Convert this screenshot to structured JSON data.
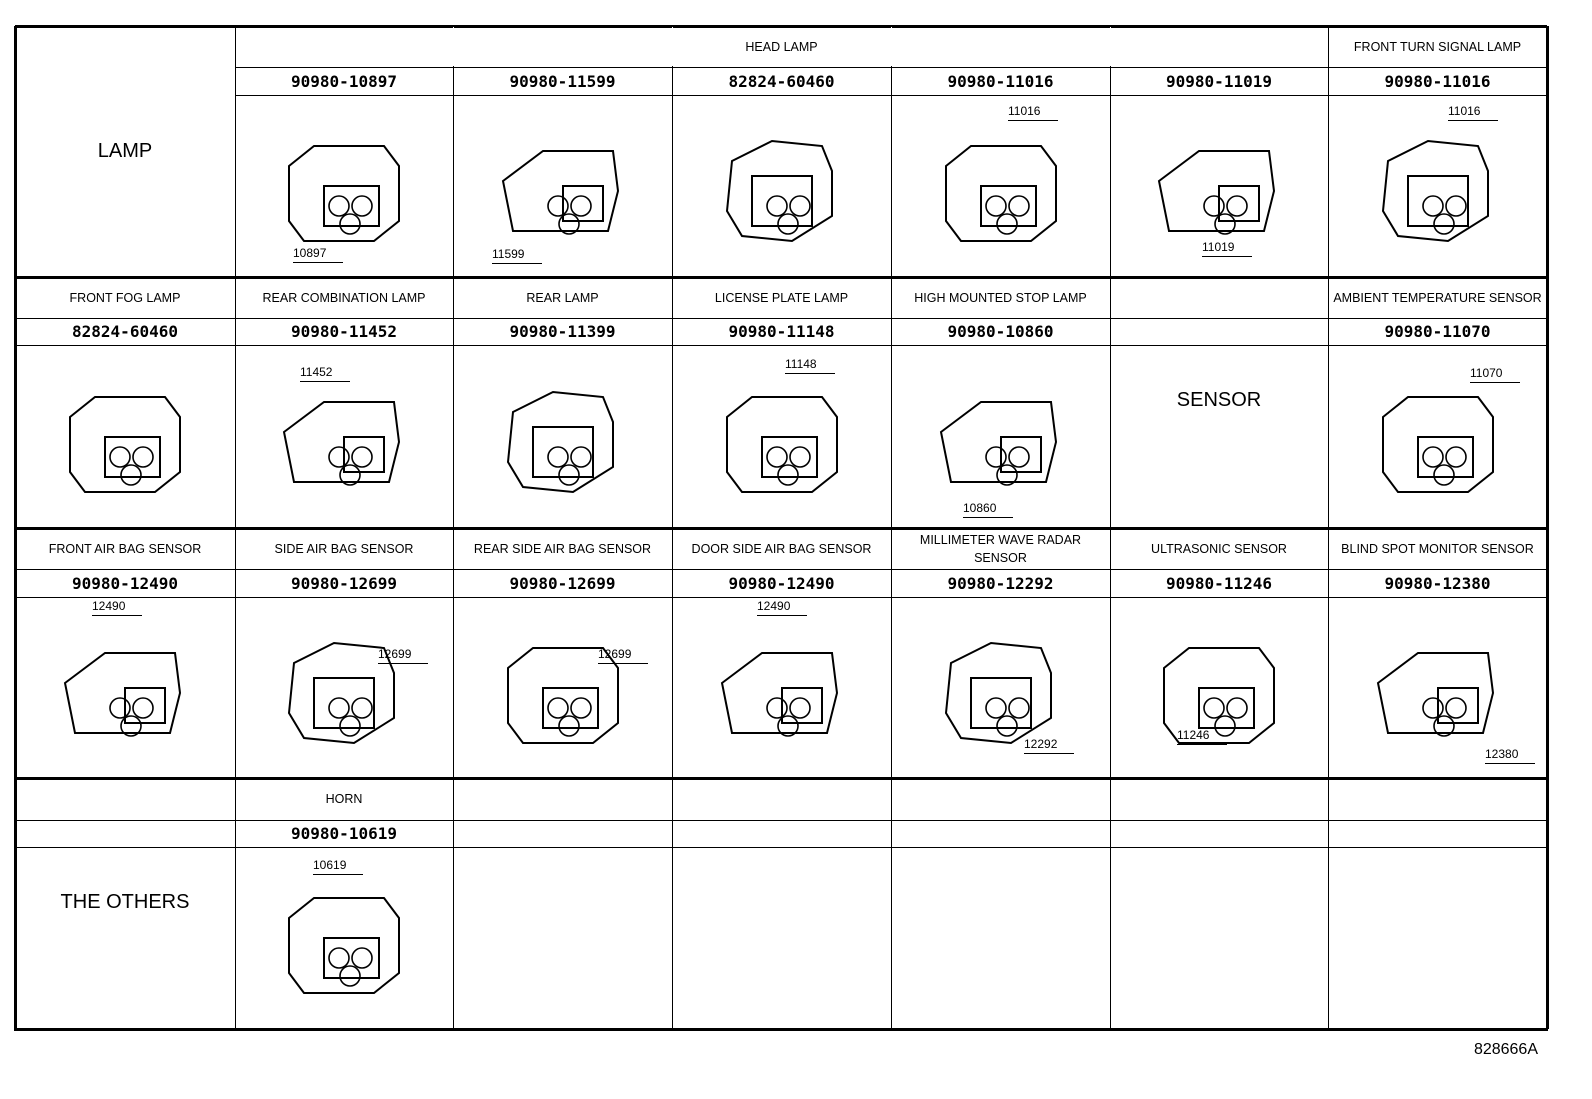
{
  "groups": [
    {
      "labels": [
        "",
        "HEAD LAMP",
        "",
        "",
        "",
        "",
        "FRONT TURN SIGNAL LAMP"
      ],
      "parts": [
        "",
        "90980-10897",
        "90980-11599",
        "82824-60460",
        "90980-11016",
        "90980-11019",
        "90980-11016"
      ],
      "callouts": [
        "",
        "10897",
        "11599",
        "",
        "11016",
        "11019",
        "11016"
      ],
      "section": "LAMP"
    },
    {
      "labels": [
        "FRONT FOG LAMP",
        "REAR COMBINATION LAMP",
        "REAR LAMP",
        "LICENSE PLATE LAMP",
        "HIGH MOUNTED STOP LAMP",
        "",
        "AMBIENT TEMPERATURE SENSOR"
      ],
      "parts": [
        "82824-60460",
        "90980-11452",
        "90980-11399",
        "90980-11148",
        "90980-10860",
        "",
        "90980-11070"
      ],
      "callouts": [
        "",
        "11452",
        "",
        "11148",
        "10860",
        "",
        "11070"
      ],
      "section": "SENSOR"
    },
    {
      "labels": [
        "FRONT AIR BAG SENSOR",
        "SIDE AIR BAG SENSOR",
        "REAR SIDE AIR BAG SENSOR",
        "DOOR SIDE AIR BAG SENSOR",
        "MILLIMETER WAVE RADAR SENSOR",
        "ULTRASONIC SENSOR",
        "BLIND SPOT MONITOR SENSOR"
      ],
      "parts": [
        "90980-12490",
        "90980-12699",
        "90980-12699",
        "90980-12490",
        "90980-12292",
        "90980-11246",
        "90980-12380"
      ],
      "callouts": [
        "12490",
        "12699",
        "12699",
        "12490",
        "12292",
        "11246",
        "12380"
      ]
    },
    {
      "labels": [
        "",
        "HORN",
        "",
        "",
        "",
        "",
        ""
      ],
      "parts": [
        "",
        "90980-10619",
        "",
        "",
        "",
        "",
        ""
      ],
      "callouts": [
        "",
        "10619",
        "",
        "",
        "",
        "",
        ""
      ],
      "section": "THE OTHERS"
    }
  ],
  "reference": "828666A"
}
